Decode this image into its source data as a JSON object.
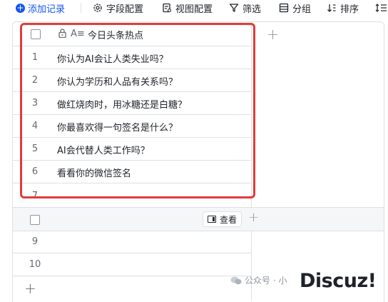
{
  "toolbar": {
    "add_record": "添加记录",
    "field_config": "字段配置",
    "view_config": "视图配置",
    "filter": "筛选",
    "group": "分组",
    "sort": "排序"
  },
  "table": {
    "field_type_glyph": "A≡",
    "column_header": "今日头条热点",
    "rows": [
      {
        "num": "1",
        "text": "你认为AI会让人类失业吗？"
      },
      {
        "num": "2",
        "text": "你认为学历和人品有关系吗？"
      },
      {
        "num": "3",
        "text": "做红烧肉时，用冰糖还是白糖？"
      },
      {
        "num": "4",
        "text": "你最喜欢得一句签名是什么？"
      },
      {
        "num": "5",
        "text": "AI会代替人类工作吗？"
      },
      {
        "num": "6",
        "text": "看看你的微信签名"
      },
      {
        "num": "7",
        "text": ""
      }
    ],
    "group_view_label": "查看",
    "group_rows": [
      {
        "num": "9",
        "text": ""
      },
      {
        "num": "10",
        "text": ""
      }
    ]
  },
  "watermark": {
    "text": "公众号 · 小",
    "brand": "Discuz!"
  },
  "colors": {
    "accent": "#1456f0",
    "highlight": "#e23b3b",
    "border": "#dee0e3"
  }
}
